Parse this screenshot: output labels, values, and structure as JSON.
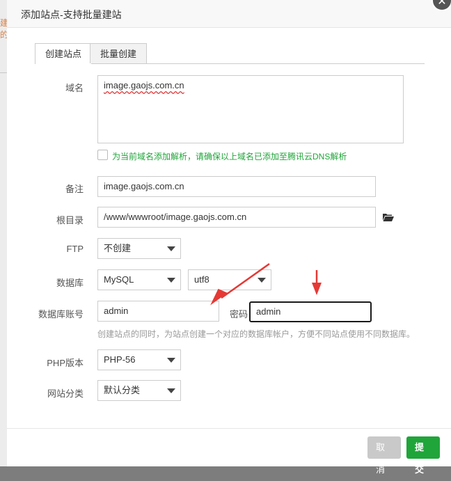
{
  "background": {
    "partial_text": "建的"
  },
  "dialog": {
    "title": "添加站点-支持批量建站"
  },
  "tabs": [
    {
      "label": "创建站点",
      "active": true
    },
    {
      "label": "批量创建",
      "active": false
    }
  ],
  "form": {
    "domain": {
      "label": "域名",
      "value": "image.gaojs.com.cn"
    },
    "dns_checkbox": {
      "label": "为当前域名添加解析，请确保以上域名已添加至腾讯云DNS解析",
      "checked": false
    },
    "remark": {
      "label": "备注",
      "value": "image.gaojs.com.cn"
    },
    "root_dir": {
      "label": "根目录",
      "value": "/www/wwwroot/image.gaojs.com.cn"
    },
    "ftp": {
      "label": "FTP",
      "value": "不创建"
    },
    "database": {
      "label": "数据库",
      "type_value": "MySQL",
      "charset_value": "utf8"
    },
    "db_account": {
      "label": "数据库账号",
      "value": "admin"
    },
    "db_password": {
      "label": "密码",
      "value": "admin"
    },
    "db_hint": "创建站点的同时，为站点创建一个对应的数据库帐户，方便不同站点使用不同数据库。",
    "php_version": {
      "label": "PHP版本",
      "value": "PHP-56"
    },
    "site_category": {
      "label": "网站分类",
      "value": "默认分类"
    }
  },
  "footer": {
    "cancel_label": "取消",
    "submit_label": "提交"
  },
  "colors": {
    "accent_green": "#20a53a",
    "arrow_red": "#e53935",
    "cancel_gray": "#c9c9c9"
  }
}
